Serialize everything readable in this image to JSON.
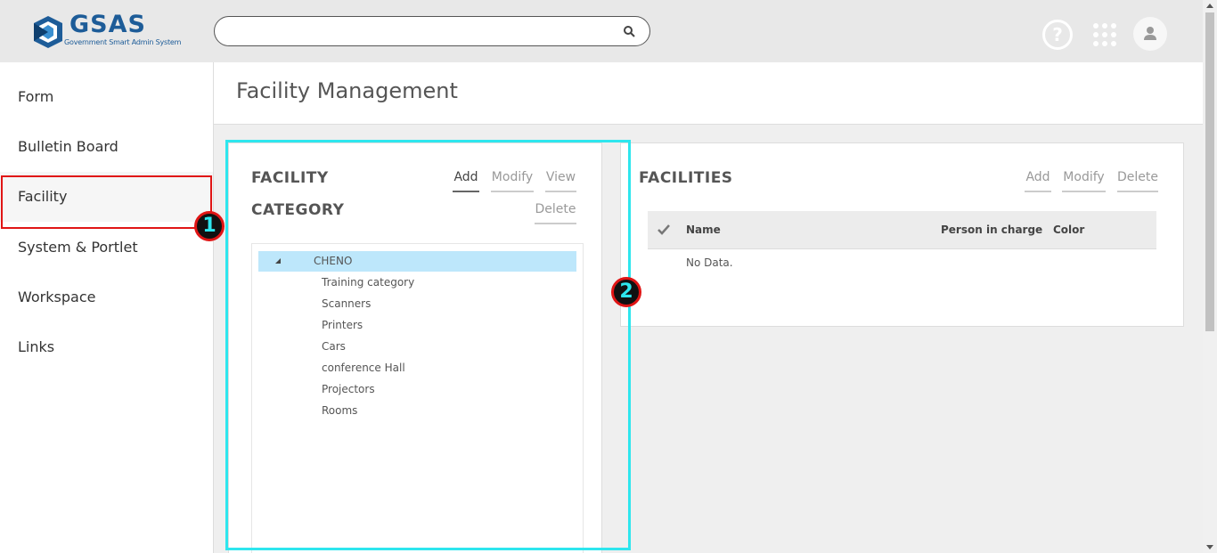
{
  "header": {
    "logo_text": "GSAS",
    "logo_subtitle": "Government Smart Admin System",
    "search": {
      "value": "",
      "placeholder": ""
    }
  },
  "sidebar": {
    "items": [
      {
        "label": "Form"
      },
      {
        "label": "Bulletin Board"
      },
      {
        "label": "Facility"
      },
      {
        "label": "System & Portlet"
      },
      {
        "label": "Workspace"
      },
      {
        "label": "Links"
      }
    ],
    "active": "Facility"
  },
  "page": {
    "title": "Facility Management"
  },
  "category_panel": {
    "title_line1": "FACILITY",
    "title_line2": "CATEGORY",
    "buttons": {
      "add": "Add",
      "modify": "Modify",
      "view": "View",
      "delete": "Delete"
    },
    "tree": {
      "root": "CHENO",
      "children": [
        "Training category",
        "Scanners",
        "Printers",
        "Cars",
        "conference Hall",
        "Projectors",
        "Rooms"
      ]
    }
  },
  "facilities_panel": {
    "title": "FACILITIES",
    "buttons": {
      "add": "Add",
      "modify": "Modify",
      "delete": "Delete"
    },
    "columns": [
      "Name",
      "Person in charge",
      "Color"
    ],
    "empty_text": "No Data."
  },
  "annotations": {
    "marker1": "1",
    "marker2": "2"
  },
  "colors": {
    "brand": "#1d5c98",
    "highlight_red": "#e01515",
    "annotation_cyan": "#2ee6ee",
    "tree_selected": "#bde7fb"
  }
}
